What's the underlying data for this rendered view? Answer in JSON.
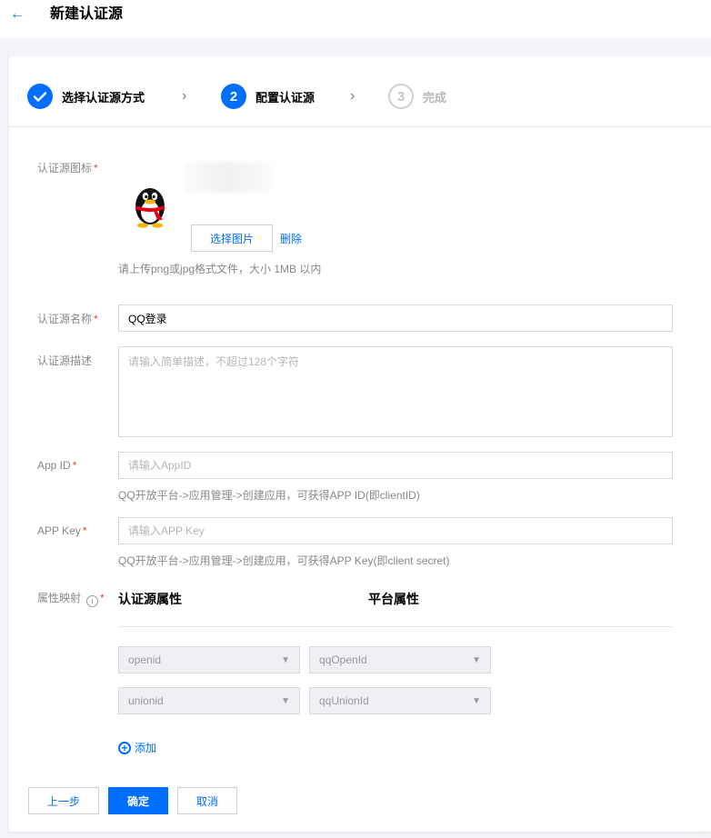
{
  "header": {
    "back_icon": "arrow-left-icon",
    "title": "新建认证源"
  },
  "steps": [
    {
      "label": "选择认证源方式",
      "state": "done"
    },
    {
      "label": "配置认证源",
      "state": "active",
      "number": "2"
    },
    {
      "label": "完成",
      "state": "pending",
      "number": "3"
    }
  ],
  "form": {
    "icon_label": "认证源图标",
    "required_mark": "*",
    "select_image_label": "选择图片",
    "delete_label": "删除",
    "upload_hint": "请上传png或jpg格式文件，大小 1MB 以内",
    "name_label": "认证源名称",
    "name_value": "QQ登录",
    "desc_label": "认证源描述",
    "desc_placeholder": "请输入简单描述，不超过128个字符",
    "appid_label": "App ID",
    "appid_placeholder": "请输入AppID",
    "appid_hint": "QQ开放平台->应用管理->创建应用，可获得APP ID(即clientID)",
    "appkey_label": "APP Key",
    "appkey_placeholder": "请输入APP Key",
    "appkey_hint": "QQ开放平台->应用管理->创建应用，可获得APP Key(即client secret)",
    "mapping_label": "属性映射",
    "info_icon": "i",
    "col_source": "认证源属性",
    "col_platform": "平台属性",
    "mappings": [
      {
        "source": "openid",
        "platform": "qqOpenId"
      },
      {
        "source": "unionid",
        "platform": "qqUnionId"
      }
    ],
    "add_label": "添加"
  },
  "footer": {
    "prev_label": "上一步",
    "confirm_label": "确定",
    "cancel_label": "取消"
  },
  "colors": {
    "accent": "#006eff",
    "required": "#e54545"
  }
}
